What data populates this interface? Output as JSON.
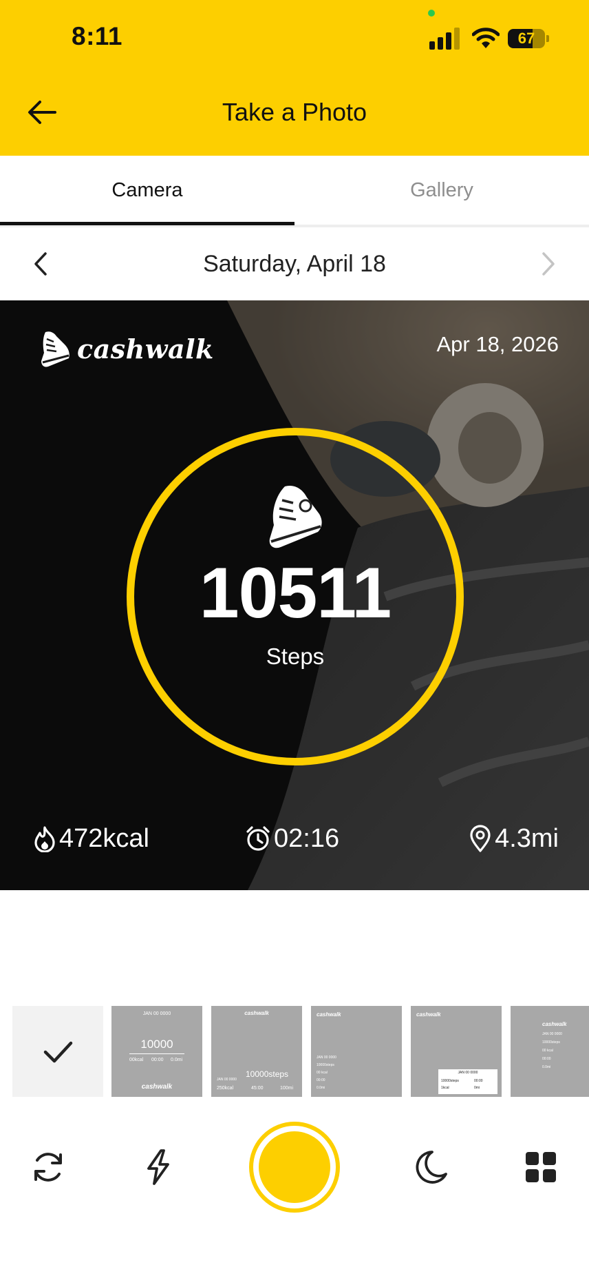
{
  "status_bar": {
    "time": "8:11",
    "battery_level": "67",
    "battery_fraction": 0.67
  },
  "header": {
    "title": "Take a Photo",
    "back_icon": "arrow-left-icon",
    "background_color": "#FDCF00"
  },
  "tabs": [
    {
      "label": "Camera",
      "active": true
    },
    {
      "label": "Gallery",
      "active": false
    }
  ],
  "date_nav": {
    "label": "Saturday, April 18",
    "prev_icon": "chevron-left-icon",
    "next_icon": "chevron-right-icon"
  },
  "preview": {
    "brand": "cashwalk",
    "date": "Apr 18, 2026",
    "steps": "10511",
    "steps_label": "Steps",
    "calories": "472kcal",
    "duration": "02:16",
    "distance": "4.3mi",
    "accent_color": "#FDCF00"
  },
  "templates": [
    {
      "id": "none",
      "selected": true
    },
    {
      "id": "t1",
      "top": "JAN 00 0000",
      "value": "10000",
      "footer": [
        "00kcal",
        "00:00",
        "0.0mi"
      ],
      "brand": "cashwalk"
    },
    {
      "id": "t2",
      "brand": "cashwalk",
      "value": "10000steps",
      "footer": [
        "250kcal",
        "45:00",
        "100mi"
      ],
      "corner": "JAN 00 0000"
    },
    {
      "id": "t3",
      "brand": "cashwalk",
      "lines": [
        "JAN 00 0000",
        "10000steps",
        "00 kcal",
        "00:00",
        "0.0mi"
      ]
    },
    {
      "id": "t4",
      "brand": "cashwalk",
      "card_date": "JAN 00 0000",
      "card_lines": [
        "10000steps",
        "00:00",
        "1kcal",
        "0mi"
      ]
    },
    {
      "id": "t5",
      "brand": "cashwalk",
      "lines": [
        "JAN 00 0000",
        "10000steps",
        "00 kcal",
        "00:00",
        "0.0mi"
      ]
    }
  ],
  "controls": {
    "switch_camera_icon": "camera-switch-icon",
    "flash_icon": "flash-icon",
    "night_mode_icon": "moon-icon",
    "layout_icon": "grid-icon"
  }
}
